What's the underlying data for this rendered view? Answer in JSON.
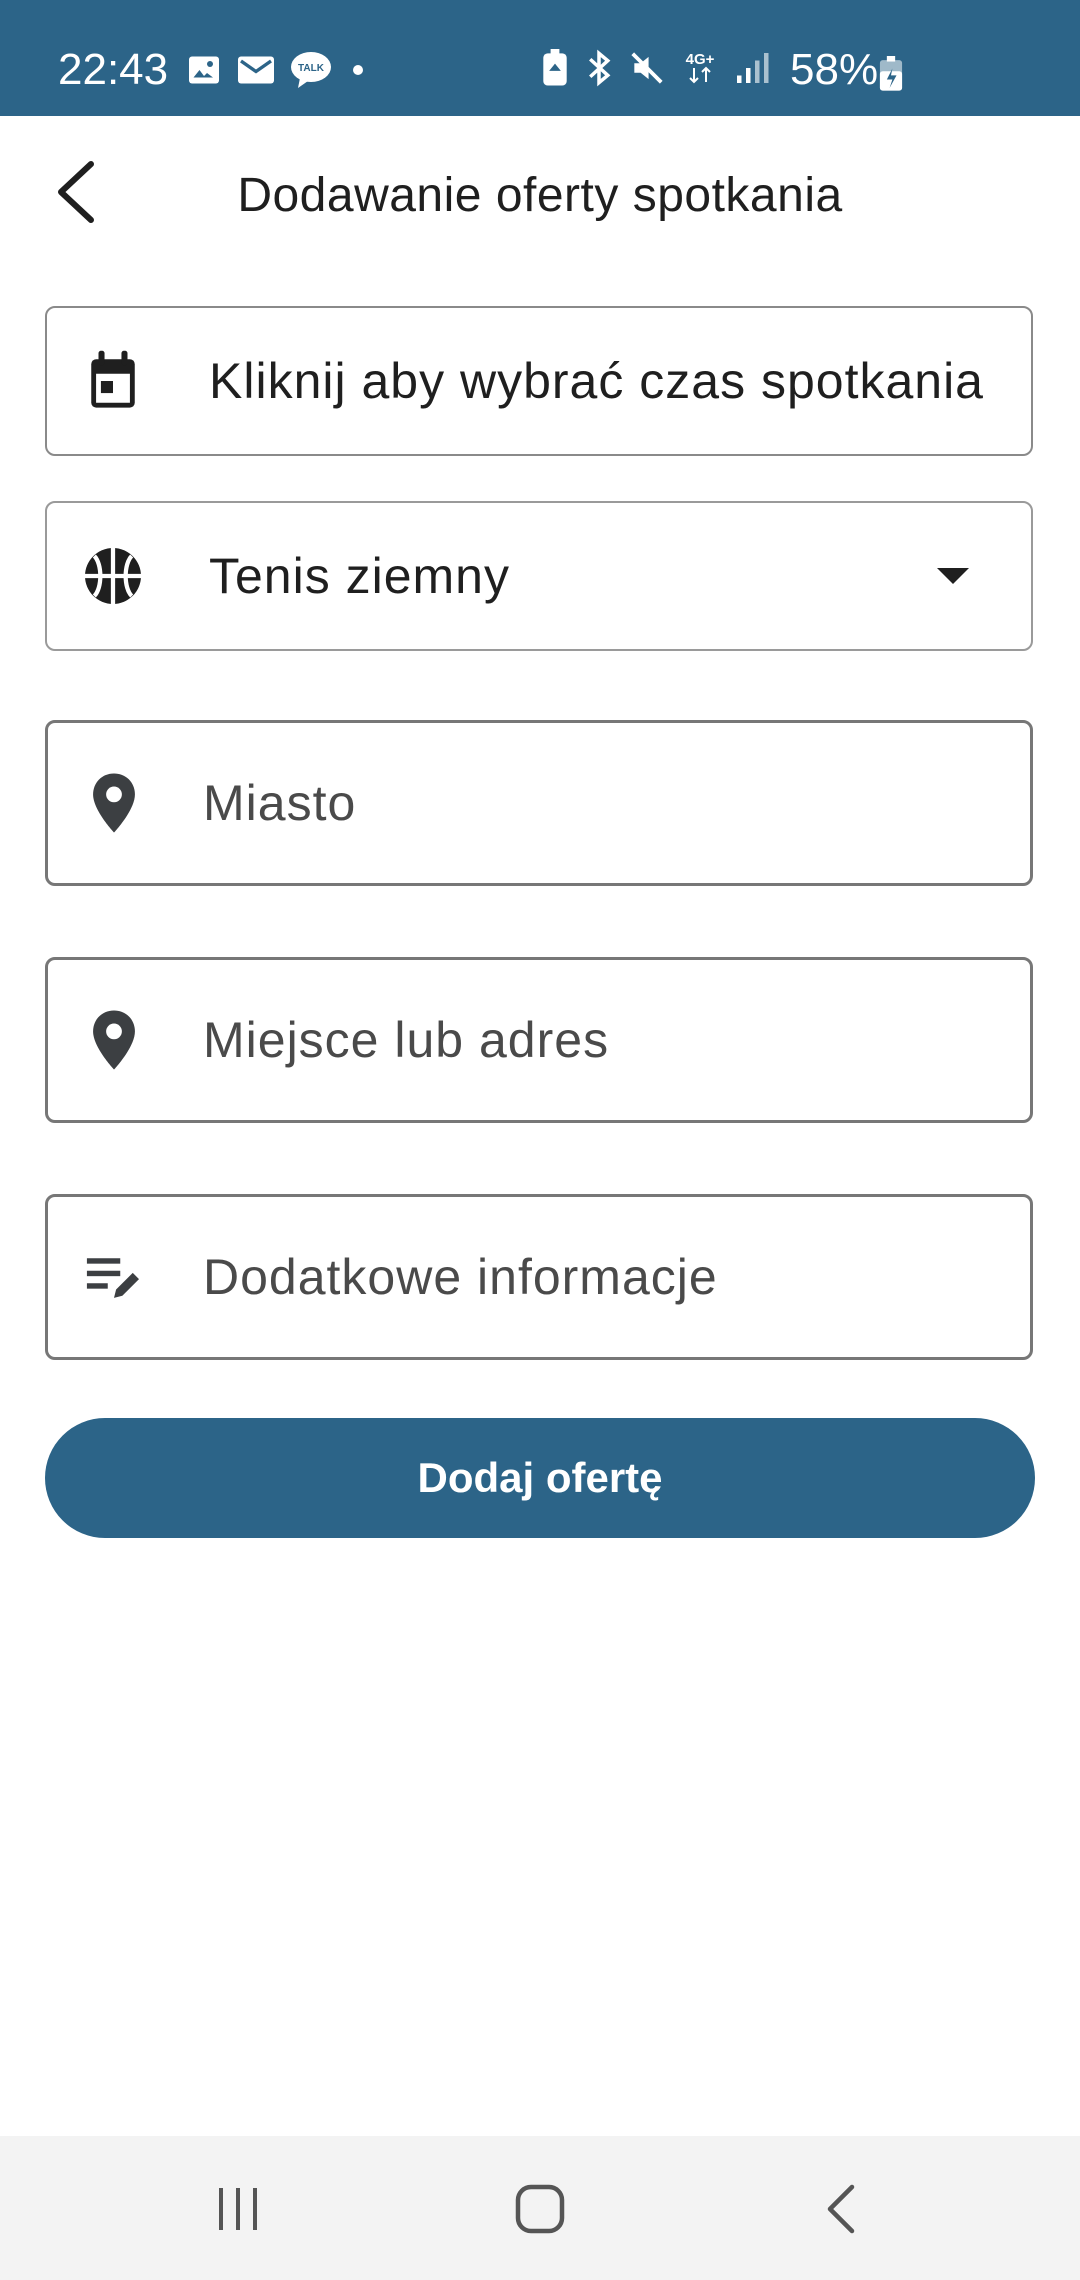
{
  "status_bar": {
    "time": "22:43",
    "battery_percent": "58%",
    "network_label": "4G+",
    "talk_label": "TALK",
    "icons": [
      "gallery-icon",
      "mail-icon",
      "talk-icon",
      "dot-icon",
      "battery-saver-icon",
      "bluetooth-icon",
      "mute-icon",
      "network-4g-icon",
      "signal-icon",
      "battery-icon"
    ]
  },
  "app_bar": {
    "title": "Dodawanie oferty spotkania",
    "back_icon": "arrow-back-icon"
  },
  "form": {
    "time_picker": {
      "label": "Kliknij aby wybrać czas spotkania",
      "icon": "calendar-icon"
    },
    "sport_select": {
      "selected": "Tenis ziemny",
      "icon": "sports-ball-icon"
    },
    "city_field": {
      "value": "",
      "placeholder": "Miasto",
      "icon": "location-pin-icon"
    },
    "place_field": {
      "value": "",
      "placeholder": "Miejsce lub adres",
      "icon": "location-pin-icon"
    },
    "info_field": {
      "value": "",
      "placeholder": "Dodatkowe informacje",
      "icon": "edit-note-icon"
    },
    "submit_label": "Dodaj ofertę"
  },
  "colors": {
    "primary": "#2c6488",
    "nav_background": "#f3f3f3"
  }
}
